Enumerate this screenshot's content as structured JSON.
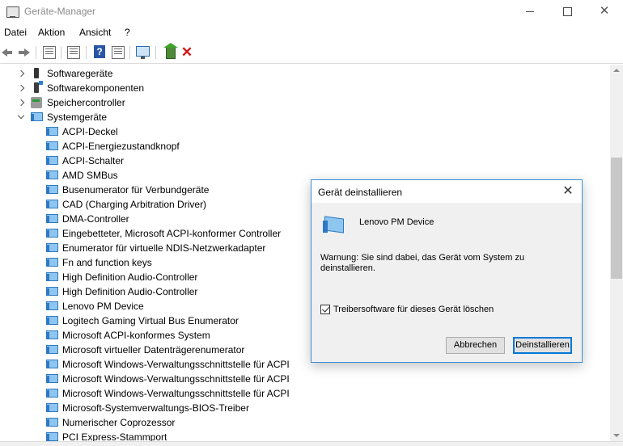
{
  "window": {
    "title": "Geräte-Manager",
    "controls": {
      "minimize": "",
      "maximize": "",
      "close": "✕"
    }
  },
  "menu": [
    "Datei",
    "Aktion",
    "Ansicht",
    "?"
  ],
  "toolbar": {
    "icons": [
      "back-icon",
      "forward-icon",
      "properties-icon",
      "view-icon",
      "help-icon",
      "view-list-icon",
      "scan-hardware-icon",
      "update-driver-icon",
      "uninstall-icon"
    ],
    "help_label": "?",
    "remove_label": "✕"
  },
  "tree": {
    "categories": [
      {
        "label": "Softwaregeräte",
        "expanded": false
      },
      {
        "label": "Softwarekomponenten",
        "expanded": false
      },
      {
        "label": "Speichercontroller",
        "expanded": false
      },
      {
        "label": "Systemgeräte",
        "expanded": true
      }
    ],
    "devices": [
      "ACPI-Deckel",
      "ACPI-Energiezustandknopf",
      "ACPI-Schalter",
      "AMD SMBus",
      "Busenumerator für Verbundgeräte",
      "CAD (Charging Arbitration Driver)",
      "DMA-Controller",
      "Eingebetteter, Microsoft ACPI-konformer Controller",
      "Enumerator für virtuelle NDIS-Netzwerkadapter",
      "Fn and function keys",
      "High Definition Audio-Controller",
      "High Definition Audio-Controller",
      "Lenovo PM Device",
      "Logitech Gaming Virtual Bus Enumerator",
      "Microsoft ACPI-konformes System",
      "Microsoft virtueller Datenträgerenumerator",
      "Microsoft Windows-Verwaltungsschnittstelle für ACPI",
      "Microsoft Windows-Verwaltungsschnittstelle für ACPI",
      "Microsoft Windows-Verwaltungsschnittstelle für ACPI",
      "Microsoft-Systemverwaltungs-BIOS-Treiber",
      "Numerischer Coprozessor",
      "PCI Express-Stammport"
    ]
  },
  "dialog": {
    "title": "Gerät deinstallieren",
    "close": "✕",
    "device_name": "Lenovo PM Device",
    "warning": "Warnung: Sie sind dabei, das Gerät vom System zu deinstallieren.",
    "checkbox_label": "Treibersoftware für dieses Gerät löschen",
    "checkbox_checked": true,
    "cancel_label": "Abbrechen",
    "ok_label": "Deinstallieren"
  }
}
